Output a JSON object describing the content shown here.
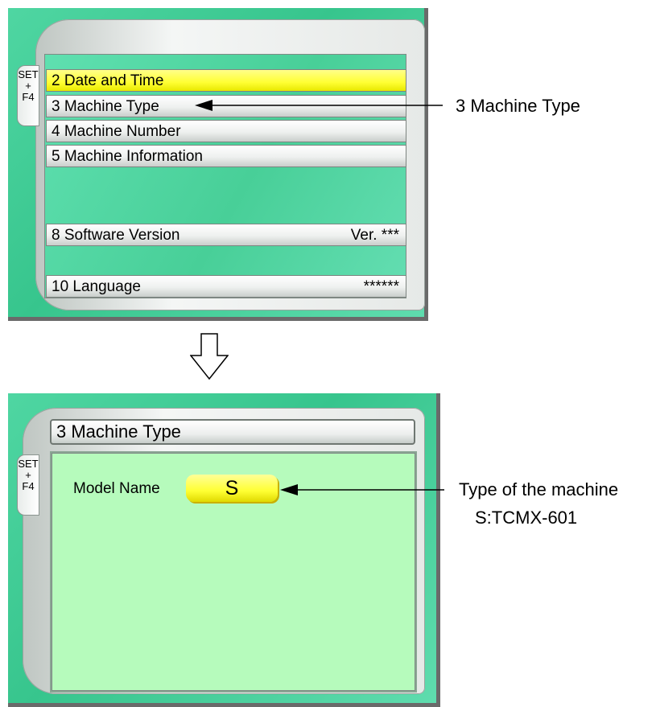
{
  "set_tab": {
    "line1": "SET",
    "line2": "+",
    "line3": "F4"
  },
  "menu": {
    "items": [
      {
        "label": "2 Date and Time",
        "value": ""
      },
      {
        "label": "3 Machine Type",
        "value": ""
      },
      {
        "label": "4 Machine Number",
        "value": ""
      },
      {
        "label": "5 Machine Information",
        "value": ""
      },
      {
        "label": "8 Software Version",
        "value": "Ver. ***"
      },
      {
        "label": "10 Language",
        "value": "******"
      }
    ],
    "selected_index": 0
  },
  "callouts": {
    "menu_item": "3 Machine Type",
    "model_line1": "Type of the machine",
    "model_line2": "S:TCMX-601"
  },
  "detail": {
    "title": "3 Machine Type",
    "model_label": "Model Name",
    "model_value": "S"
  },
  "colors": {
    "panel_green": "#37c58d",
    "selected_yellow": "#ffff33",
    "detail_screen": "#b6fbbc"
  },
  "icons": {
    "transition_arrow": "down-arrow-icon"
  }
}
